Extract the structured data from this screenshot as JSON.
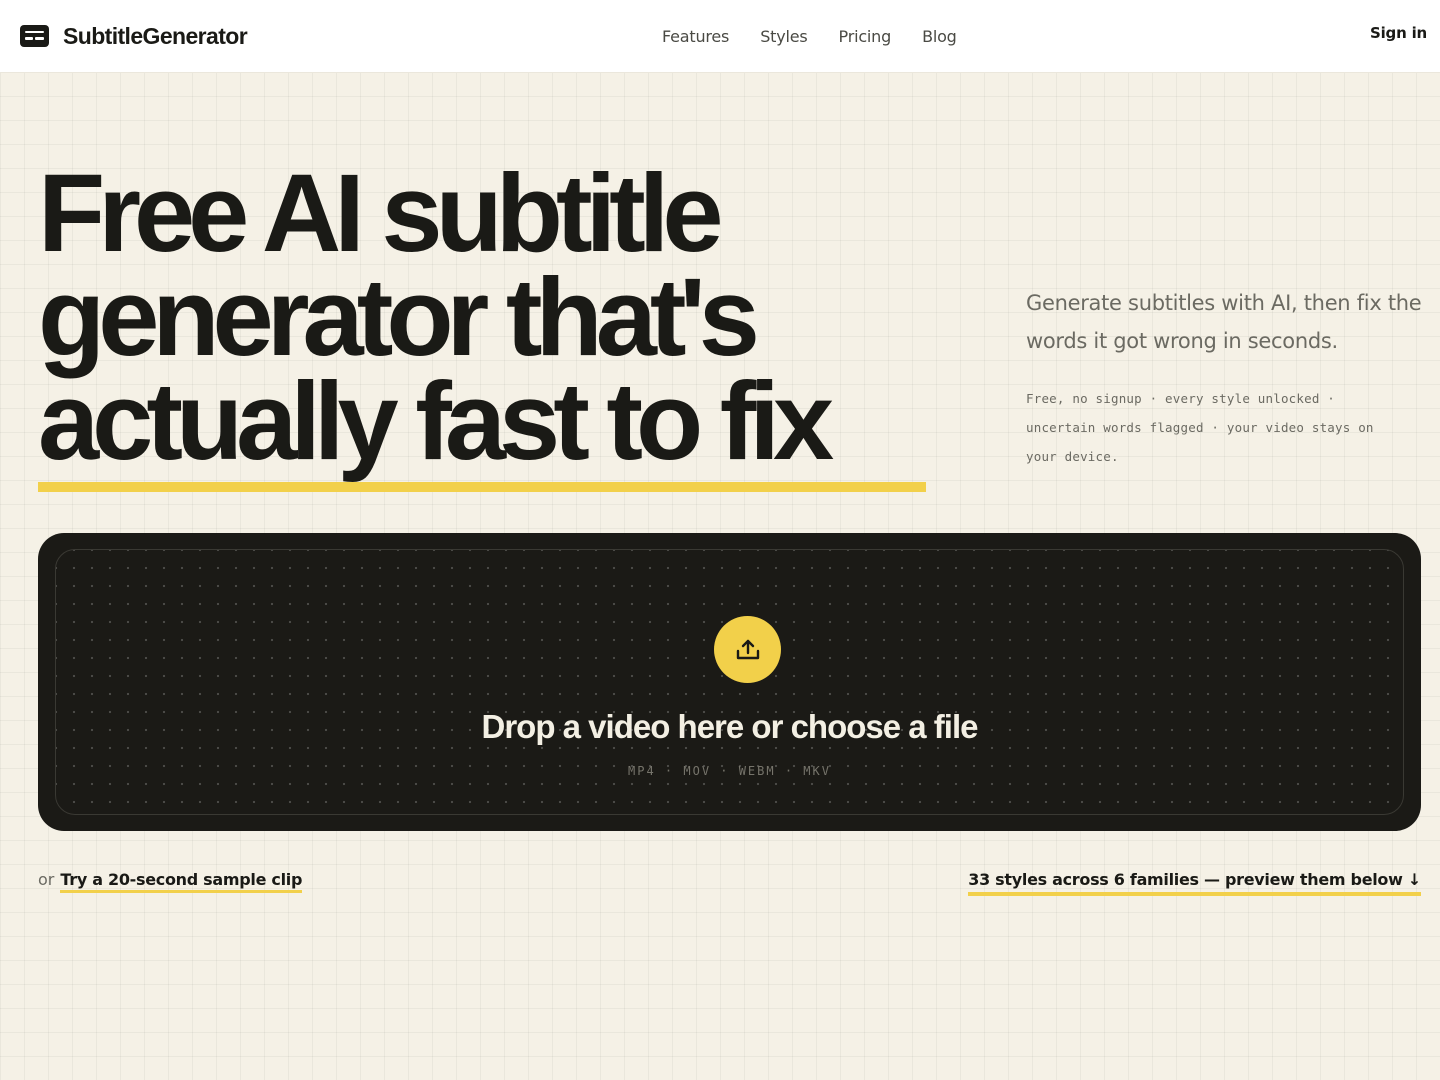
{
  "brand": {
    "name": "SubtitleGenerator",
    "icon": "captions-icon"
  },
  "nav": {
    "items": [
      "Features",
      "Styles",
      "Pricing",
      "Blog"
    ],
    "signin": "Sign in"
  },
  "hero": {
    "headline_lines": [
      "Free AI subtitle",
      "generator that's",
      "actually fast to fix"
    ],
    "lede": "Generate subtitles with AI, then fix the words it got wrong in seconds.",
    "note": "Free, no signup · every style unlocked · uncertain words flagged · your video stays on your device."
  },
  "dropzone": {
    "icon": "upload-icon",
    "title": "Drop a video here or choose a file",
    "formats": "MP4 · MOV · WEBM · MKV"
  },
  "footer_links": {
    "or_text": "or",
    "sample": "Try a 20-second sample clip",
    "styles": "33 styles across 6 families — preview them below ↓"
  },
  "colors": {
    "accent": "#f2d04a",
    "background": "#f5f1e6",
    "dark": "#1b1a16"
  }
}
